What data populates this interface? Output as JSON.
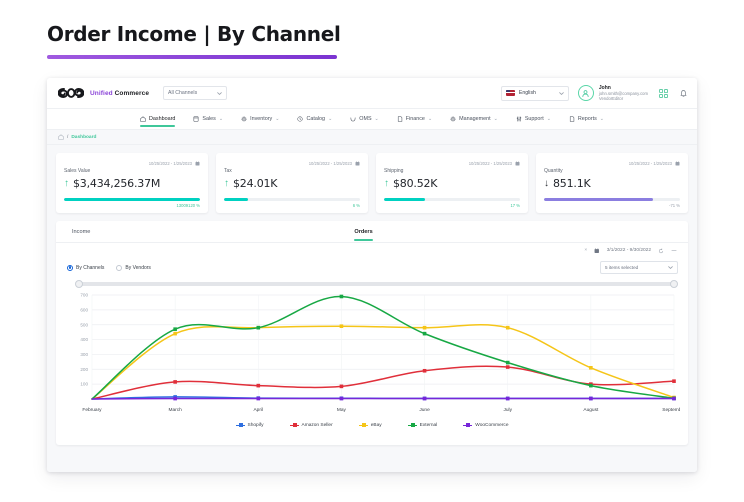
{
  "title": "Order Income | By Channel",
  "app": {
    "logo_text_1": "Unified",
    "logo_text_2": "Commerce",
    "channel_filter": "All Channels",
    "language": "English",
    "user": {
      "name": "John",
      "email": "john.smith@company.com",
      "role": "VendorEditor"
    },
    "nav": [
      {
        "label": "Dashboard",
        "icon": "home-icon",
        "active": true,
        "caret": false
      },
      {
        "label": "Sales",
        "icon": "tablet-icon",
        "active": false,
        "caret": true
      },
      {
        "label": "Inventory",
        "icon": "gear-icon",
        "active": false,
        "caret": true
      },
      {
        "label": "Catalog",
        "icon": "tag-icon",
        "active": false,
        "caret": true
      },
      {
        "label": "OMS",
        "icon": "smile-icon",
        "active": false,
        "caret": true
      },
      {
        "label": "Finance",
        "icon": "document-icon",
        "active": false,
        "caret": true
      },
      {
        "label": "Management",
        "icon": "gear-icon",
        "active": false,
        "caret": true
      },
      {
        "label": "Support",
        "icon": "sliders-icon",
        "active": false,
        "caret": true
      },
      {
        "label": "Reports",
        "icon": "document-icon",
        "active": false,
        "caret": true
      }
    ],
    "breadcrumb": {
      "home": "home-icon",
      "separator": "/",
      "current": "Dashboard"
    }
  },
  "kpis": [
    {
      "label": "Sales Value",
      "value": "$3,434,256.37M",
      "date_range": "10/25/2022 - 1/25/2023",
      "direction": "up",
      "percent": "13009120 %",
      "bar_fill": 100,
      "bar_color": "#00d1c1",
      "pct_color": "#3fc79a"
    },
    {
      "label": "Tax",
      "value": "$24.01K",
      "date_range": "10/25/2022 - 1/25/2023",
      "direction": "up",
      "percent": "6 %",
      "bar_fill": 18,
      "bar_color": "#00d1c1",
      "pct_color": "#3fc79a"
    },
    {
      "label": "Shipping",
      "value": "$80.52K",
      "date_range": "10/25/2022 - 1/25/2023",
      "direction": "up",
      "percent": "17 %",
      "bar_fill": 30,
      "bar_color": "#00d1c1",
      "pct_color": "#3fc79a"
    },
    {
      "label": "Quantity",
      "value": "851.1K",
      "date_range": "10/25/2022 - 1/25/2023",
      "direction": "down",
      "percent": "-71 %",
      "bar_fill": 80,
      "bar_color": "#8b7ee0",
      "pct_color": "#9aa1ac"
    }
  ],
  "panel": {
    "tabs": [
      {
        "label": "Income",
        "active": false
      },
      {
        "label": "Orders",
        "active": true
      }
    ],
    "toolbar": {
      "clear": "×",
      "calendar_icon": "calendar-icon",
      "date_range": "3/1/2022 - 9/30/2022",
      "refresh_icon": "refresh-icon",
      "more_icon": "more-icon"
    },
    "grouping": {
      "option_1": "By Channels",
      "option_2": "By Vendors",
      "selected": "By Channels"
    },
    "items_select": "5 items selected"
  },
  "chart_data": {
    "type": "line",
    "title": "",
    "xlabel": "",
    "ylabel": "",
    "ylim": [
      0,
      700
    ],
    "yticks": [
      100,
      200,
      300,
      400,
      500,
      600,
      700
    ],
    "grid": true,
    "legend_position": "bottom",
    "categories": [
      "February",
      "March",
      "April",
      "May",
      "June",
      "July",
      "August",
      "September"
    ],
    "series": [
      {
        "name": "Shopify",
        "color": "#2f6fe0",
        "values": [
          0,
          14,
          6,
          5,
          4,
          4,
          4,
          4
        ]
      },
      {
        "name": "Amazon Seller",
        "color": "#e02f3a",
        "values": [
          0,
          115,
          90,
          85,
          190,
          215,
          100,
          120
        ]
      },
      {
        "name": "eBay",
        "color": "#f5c518",
        "values": [
          0,
          440,
          480,
          490,
          480,
          480,
          210,
          10
        ]
      },
      {
        "name": "External",
        "color": "#17a844",
        "values": [
          0,
          470,
          480,
          690,
          440,
          245,
          90,
          5
        ]
      },
      {
        "name": "WooCommerce",
        "color": "#7726d9",
        "values": [
          0,
          3,
          3,
          3,
          3,
          3,
          3,
          3
        ]
      }
    ]
  }
}
